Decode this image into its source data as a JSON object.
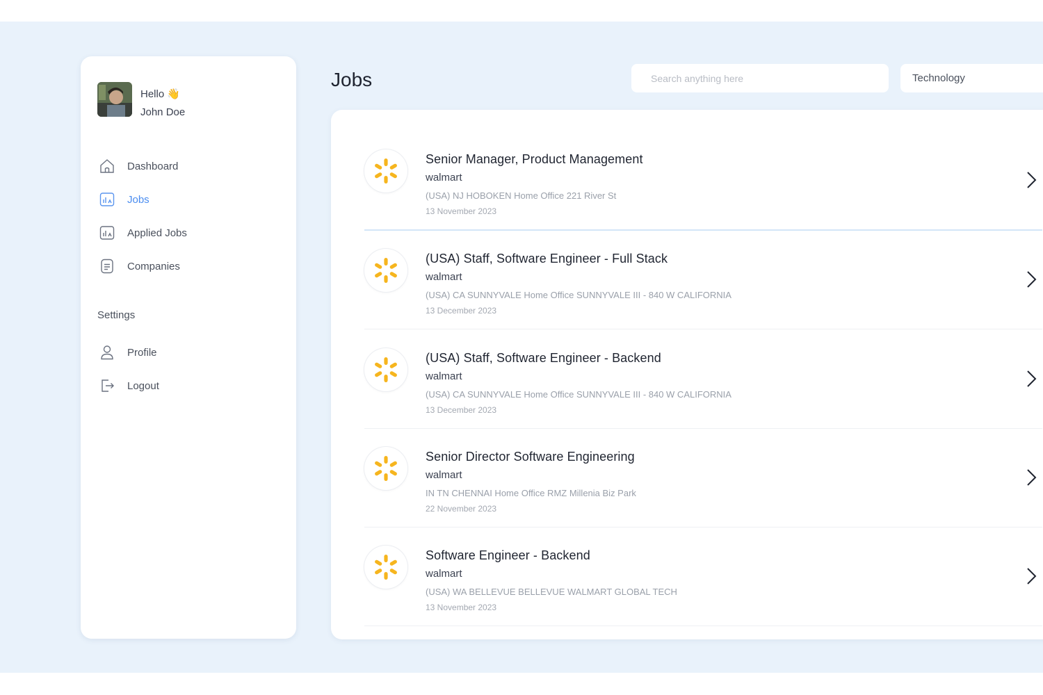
{
  "user": {
    "greeting": "Hello",
    "greeting_emoji": "👋",
    "name": "John Doe"
  },
  "nav": {
    "items": [
      {
        "label": "Dashboard",
        "icon": "home-icon"
      },
      {
        "label": "Jobs",
        "icon": "jobs-icon",
        "active": true
      },
      {
        "label": "Applied Jobs",
        "icon": "applied-jobs-icon"
      },
      {
        "label": "Companies",
        "icon": "companies-icon"
      }
    ],
    "settings_title": "Settings",
    "settings_items": [
      {
        "label": "Profile",
        "icon": "user-icon"
      },
      {
        "label": "Logout",
        "icon": "logout-icon"
      }
    ]
  },
  "header": {
    "title": "Jobs",
    "search_placeholder": "Search anything here",
    "category": "Technology"
  },
  "jobs": [
    {
      "title": "Senior Manager, Product Management",
      "company": "walmart",
      "location": "(USA) NJ HOBOKEN Home Office 221 River St",
      "date": "13 November 2023"
    },
    {
      "title": "(USA) Staff, Software Engineer - Full Stack",
      "company": "walmart",
      "location": "(USA) CA SUNNYVALE Home Office SUNNYVALE III - 840 W CALIFORNIA",
      "date": "13 December 2023"
    },
    {
      "title": "(USA) Staff, Software Engineer - Backend",
      "company": "walmart",
      "location": "(USA) CA SUNNYVALE Home Office SUNNYVALE III - 840 W CALIFORNIA",
      "date": "13 December 2023"
    },
    {
      "title": "Senior Director Software Engineering",
      "company": "walmart",
      "location": "IN TN CHENNAI Home Office RMZ Millenia Biz Park",
      "date": "22 November 2023"
    },
    {
      "title": "Software Engineer - Backend",
      "company": "walmart",
      "location": "(USA) WA BELLEVUE BELLEVUE WALMART GLOBAL TECH",
      "date": "13 November 2023"
    }
  ],
  "colors": {
    "background": "#e9f2fb",
    "accent": "#4b8df0",
    "logo_yellow": "#f6b51e"
  }
}
